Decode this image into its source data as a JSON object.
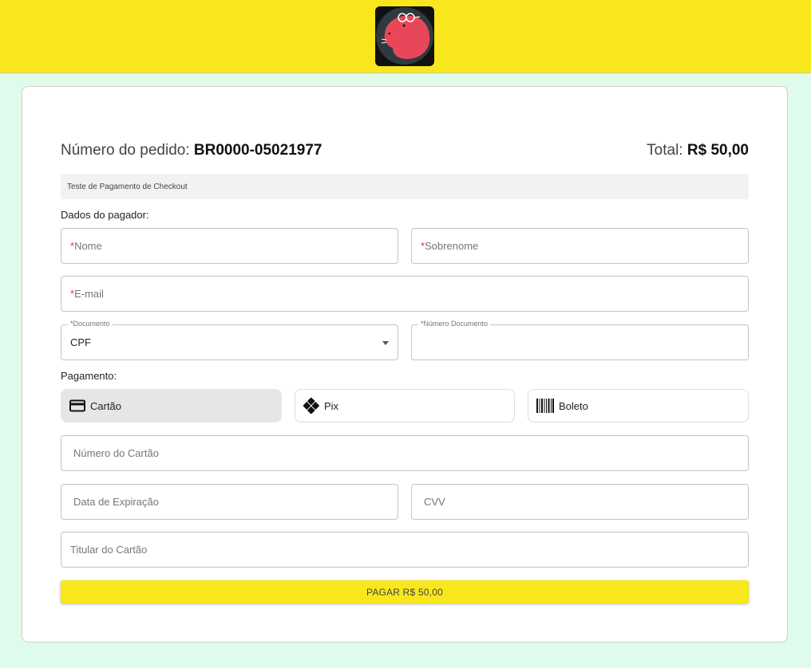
{
  "header": {
    "logo_icon": "capybara-logo-icon",
    "brand_color": "#f8e71c"
  },
  "order": {
    "number_label": "Número do pedido:",
    "number_value": "BR0000-05021977",
    "total_label": "Total:",
    "total_value": "R$ 50,00",
    "description": "Teste de Pagamento de Checkout"
  },
  "payer": {
    "section_label": "Dados do pagador:",
    "required_mark": "*",
    "first_name_placeholder": "Nome",
    "last_name_placeholder": "Sobrenome",
    "email_placeholder": "E-mail",
    "document_label": "Documento",
    "document_value": "CPF",
    "document_number_label": "Número Documento"
  },
  "payment": {
    "section_label": "Pagamento:",
    "methods": [
      {
        "label": "Cartão",
        "icon": "credit-card-icon",
        "selected": true
      },
      {
        "label": "Pix",
        "icon": "pix-icon",
        "selected": false
      },
      {
        "label": "Boleto",
        "icon": "barcode-icon",
        "selected": false
      }
    ],
    "card_number_placeholder": "Número do Cartão",
    "expiry_placeholder": "Data de Expiração",
    "cvv_placeholder": "CVV",
    "holder_placeholder": "Titular do Cartão",
    "pay_button": "PAGAR R$ 50,00"
  },
  "colors": {
    "background": "#dffbec",
    "accent": "#f8e71c",
    "required": "#dd3333"
  }
}
